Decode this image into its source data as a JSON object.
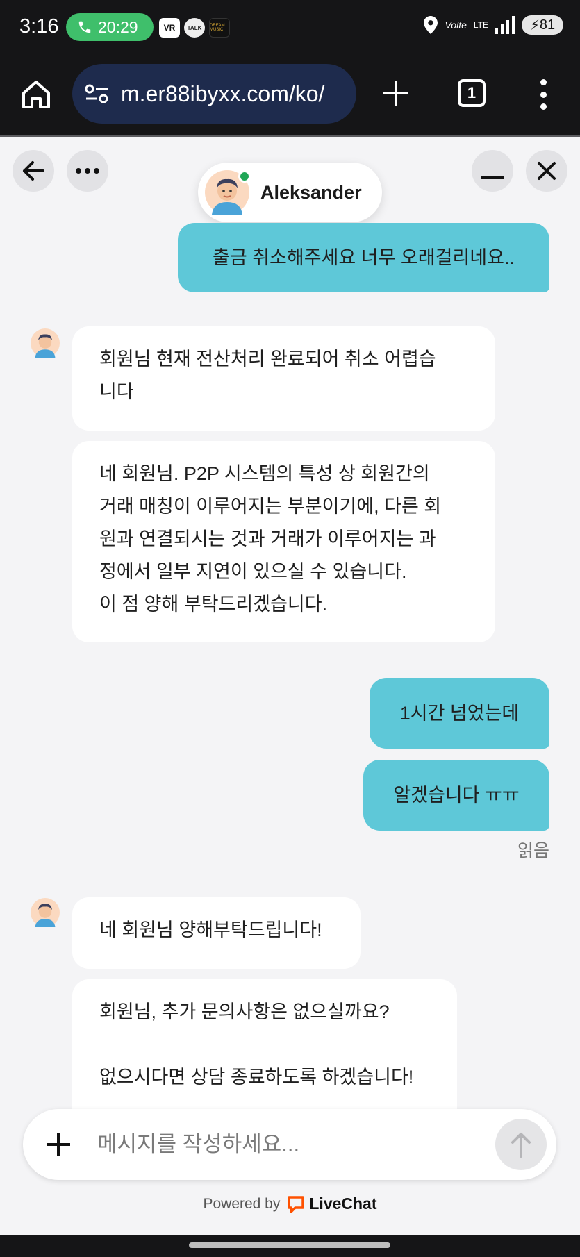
{
  "status_bar": {
    "time": "3:16",
    "call_time": "20:29",
    "notif_vr": "VR",
    "notif_talk": "TALK",
    "notif_dm": "DREAM MUSIC",
    "volte": "Volte",
    "lte": "LTE",
    "battery": "81"
  },
  "browser": {
    "url": "m.er88ibyxx.com/ko/",
    "tab_count": "1"
  },
  "chat": {
    "agent_name": "Aleksander",
    "messages": [
      {
        "direction": "out",
        "text": "출금 취소해주세요 너무 오래걸리네요.."
      },
      {
        "direction": "in",
        "text": "회원님 현재 전산처리 완료되어 취소 어렵습\n니다"
      },
      {
        "direction": "in",
        "text": "네 회원님. P2P 시스템의 특성 상 회원간의\n거래 매칭이 이루어지는 부분이기에, 다른 회\n원과 연결되시는 것과 거래가 이루어지는 과\n정에서 일부 지연이 있으실 수 있습니다.\n이 점 양해 부탁드리겠습니다."
      },
      {
        "direction": "out",
        "text": "1시간 넘었는데"
      },
      {
        "direction": "out",
        "text": "알겠습니다 ㅠㅠ"
      },
      {
        "direction": "in",
        "text": "네 회원님 양해부탁드립니다!"
      },
      {
        "direction": "in",
        "text": "회원님, 추가 문의사항은 없으실까요?\n\n없으시다면 상담 종료하도록 하겠습니다!"
      }
    ],
    "read_label": "읽음"
  },
  "composer": {
    "placeholder": "메시지를 작성하세요..."
  },
  "footer": {
    "powered_by": "Powered by",
    "brand": "LiveChat"
  },
  "colors": {
    "outgoing_bubble": "#5ec8d8",
    "incoming_bubble": "#ffffff",
    "background": "#f4f4f6",
    "url_pill": "#1e2b4d",
    "livechat_orange": "#ff5100",
    "online_green": "#1fa656"
  }
}
